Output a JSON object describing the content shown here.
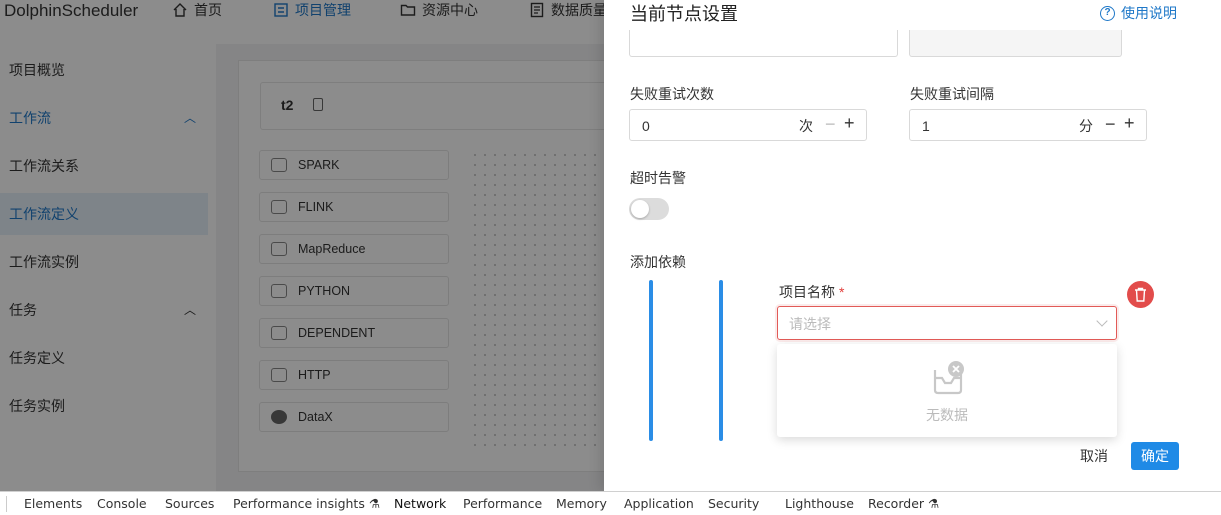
{
  "app": {
    "logo": "DolphinScheduler",
    "topnav": [
      {
        "label": "首页",
        "icon": "home-icon"
      },
      {
        "label": "项目管理",
        "icon": "project-icon",
        "active": true
      },
      {
        "label": "资源中心",
        "icon": "folder-icon"
      },
      {
        "label": "数据质量",
        "icon": "document-icon"
      }
    ]
  },
  "sidebar": {
    "items": [
      {
        "label": "项目概览"
      },
      {
        "label": "工作流",
        "expanded": true
      },
      {
        "label": "工作流关系"
      },
      {
        "label": "工作流定义",
        "selected": true
      },
      {
        "label": "工作流实例"
      },
      {
        "label": "任务",
        "expanded": true
      },
      {
        "label": "任务定义"
      },
      {
        "label": "任务实例"
      }
    ]
  },
  "workflow": {
    "name": "t2",
    "tasks": [
      "SPARK",
      "FLINK",
      "MapReduce",
      "PYTHON",
      "DEPENDENT",
      "HTTP",
      "DataX"
    ]
  },
  "drawer": {
    "title": "当前节点设置",
    "help_label": "使用说明",
    "retry_times": {
      "label": "失败重试次数",
      "value": "0",
      "unit": "次"
    },
    "retry_interval": {
      "label": "失败重试间隔",
      "value": "1",
      "unit": "分"
    },
    "timeout_alert": {
      "label": "超时告警",
      "enabled": false
    },
    "add_dependency": {
      "label": "添加依赖"
    },
    "project_name": {
      "label": "项目名称",
      "required_mark": "*",
      "placeholder": "请选择"
    },
    "dropdown": {
      "empty_text": "无数据"
    },
    "cancel_label": "取消",
    "confirm_label": "确定"
  },
  "devtools": {
    "tabs": [
      "Elements",
      "Console",
      "Sources",
      "Performance insights",
      "Network",
      "Performance",
      "Memory",
      "Application",
      "Security",
      "Lighthouse",
      "Recorder"
    ],
    "active": "Network"
  },
  "colors": {
    "accent": "#1f78c8",
    "primary_button": "#1f8ae6",
    "danger": "#e24c4b",
    "dependency_bar": "#2a8de6"
  }
}
